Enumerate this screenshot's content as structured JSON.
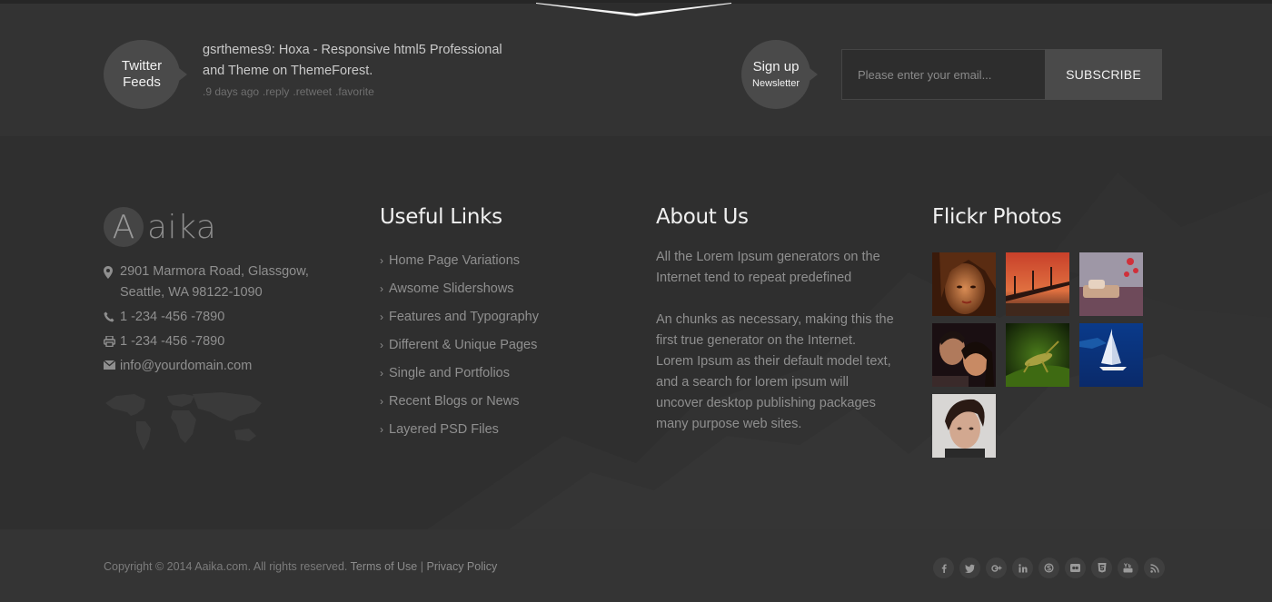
{
  "newsletter_strip": {
    "twitter_badge": {
      "line1": "Twitter",
      "line2": "Feeds"
    },
    "tweet": {
      "text": "gsrthemes9: Hoxa - Responsive html5 Professional and Theme on ThemeForest.",
      "time": ".9 days ago",
      "actions": [
        ".reply",
        ".retweet",
        ".favorite"
      ]
    },
    "signup_badge": {
      "line1": "Sign up",
      "line2": "Newsletter"
    },
    "email_placeholder": "Please enter your email...",
    "subscribe_label": "SUBSCRIBE"
  },
  "brand": {
    "letter": "A",
    "rest": "aika"
  },
  "contact": {
    "address_line1": "2901 Marmora Road, Glassgow,",
    "address_line2": "Seattle, WA 98122-1090",
    "phone": "1 -234 -456 -7890",
    "fax": "1 -234 -456 -7890",
    "email": "info@yourdomain.com"
  },
  "useful_links": {
    "heading": "Useful Links",
    "items": [
      "Home Page Variations",
      "Awsome Slidershows",
      "Features and Typography",
      "Different & Unique Pages",
      "Single and Portfolios",
      "Recent Blogs or News",
      "Layered PSD Files"
    ]
  },
  "about": {
    "heading": "About Us",
    "paragraph1": "All the Lorem Ipsum generators on the Internet tend to repeat predefined",
    "paragraph2": "An chunks as necessary, making this the first true generator on the Internet. Lorem Ipsum as their default model text, and a search for lorem ipsum will uncover desktop publishing packages many purpose web sites."
  },
  "flickr": {
    "heading": "Flickr Photos",
    "photos": [
      "woman-portrait",
      "bridge-sunset",
      "bedroom-interior",
      "couple-portrait",
      "grasshopper-leaf",
      "sailboat-sea",
      "young-man-portrait"
    ]
  },
  "footer": {
    "copyright": "Copyright © 2014 Aaika.com. All rights reserved.",
    "terms": "Terms of Use",
    "separator": "|",
    "privacy": "Privacy Policy",
    "social": [
      "facebook",
      "twitter",
      "google-plus",
      "linkedin",
      "skype",
      "flickr",
      "html5",
      "youtube",
      "rss"
    ]
  },
  "colors": {
    "page_bg": "#2d2d2d",
    "strip_bg": "#333333",
    "badge_bg": "#4a4a4a",
    "heading": "#f0f0f0",
    "text": "#8f8f8f"
  }
}
